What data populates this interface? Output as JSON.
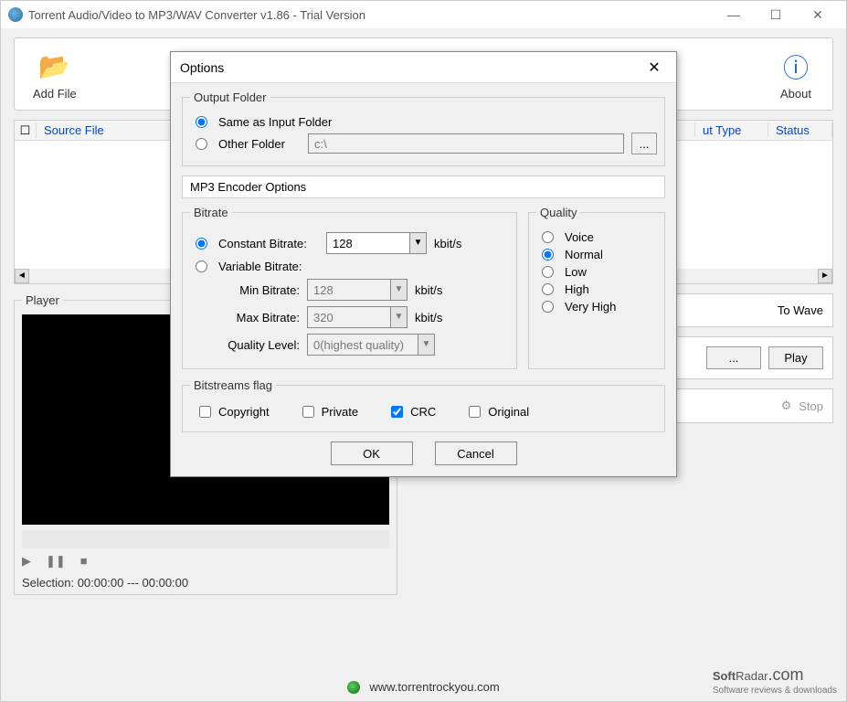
{
  "window": {
    "title": "Torrent Audio/Video to MP3/WAV Converter v1.86 - Trial Version"
  },
  "toolbar": {
    "add_file": "Add File",
    "about": "About"
  },
  "filelist": {
    "cols": {
      "source": "Source File",
      "out_type": "ut Type",
      "status": "Status"
    }
  },
  "player": {
    "legend": "Player",
    "selection": "Selection: 00:00:00 --- 00:00:00"
  },
  "right": {
    "to_wave": "To Wave",
    "browse": "...",
    "play": "Play",
    "stop": "Stop"
  },
  "footer": {
    "url": "www.torrentrockyou.com",
    "brand": "SoftRadar.com",
    "tag": "Software reviews & downloads"
  },
  "dialog": {
    "title": "Options",
    "output_folder": {
      "legend": "Output Folder",
      "same": "Same as Input Folder",
      "other": "Other Folder",
      "path": "c:\\",
      "browse": "..."
    },
    "encoder_header": "MP3 Encoder Options",
    "bitrate": {
      "legend": "Bitrate",
      "constant": "Constant Bitrate:",
      "variable": "Variable Bitrate:",
      "min": "Min Bitrate:",
      "max": "Max Bitrate:",
      "quality_lvl": "Quality Level:",
      "val_const": "128",
      "val_min": "128",
      "val_max": "320",
      "val_q": "0(highest quality)",
      "unit": "kbit/s"
    },
    "quality": {
      "legend": "Quality",
      "voice": "Voice",
      "normal": "Normal",
      "low": "Low",
      "high": "High",
      "very_high": "Very High"
    },
    "flags": {
      "legend": "Bitstreams flag",
      "copyright": "Copyright",
      "private": "Private",
      "crc": "CRC",
      "original": "Original"
    },
    "ok": "OK",
    "cancel": "Cancel"
  }
}
